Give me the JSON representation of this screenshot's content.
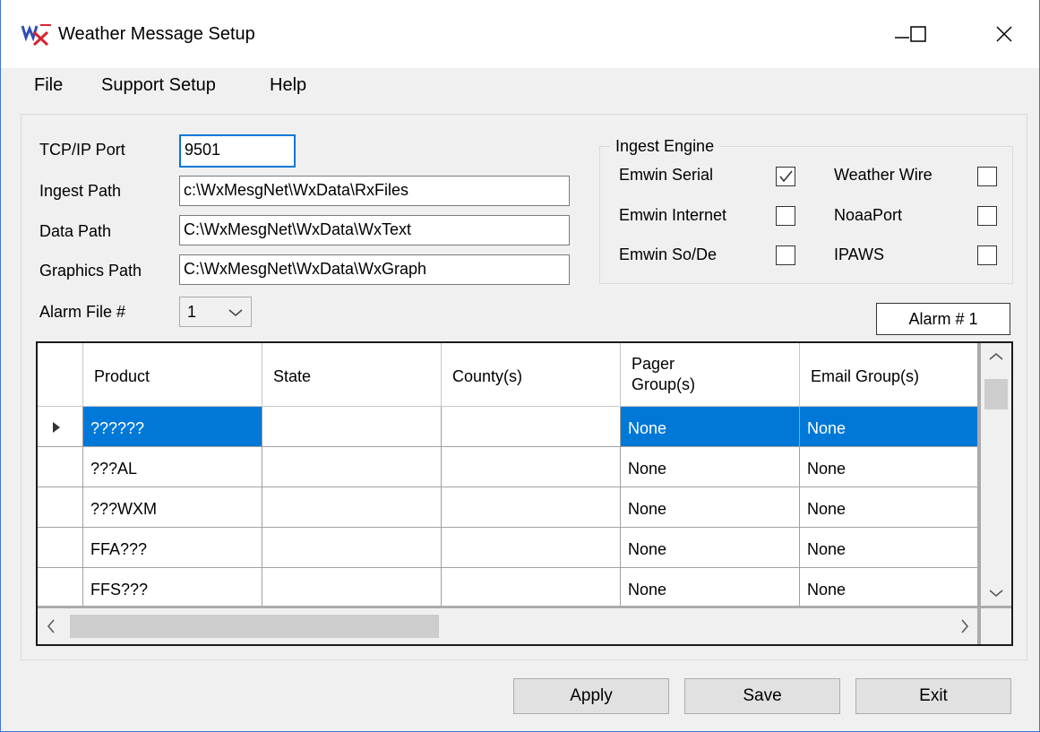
{
  "window": {
    "title": "Weather Message Setup"
  },
  "menu": {
    "file": "File",
    "support_setup": "Support Setup",
    "help": "Help"
  },
  "form": {
    "tcp_label": "TCP/IP Port",
    "tcp_value": "9501",
    "ingest_label": "Ingest Path",
    "ingest_value": "c:\\WxMesgNet\\WxData\\RxFiles",
    "data_label": "Data Path",
    "data_value": "C:\\WxMesgNet\\WxData\\WxText",
    "graphics_label": "Graphics Path",
    "graphics_value": "C:\\WxMesgNet\\WxData\\WxGraph",
    "alarm_label": "Alarm File #",
    "alarm_value": "1"
  },
  "ingest": {
    "legend": "Ingest Engine",
    "emwin_serial": "Emwin Serial",
    "emwin_internet": "Emwin Internet",
    "emwin_sode": "Emwin So/De",
    "weather_wire": "Weather Wire",
    "noaaport": "NoaaPort",
    "ipaws": "IPAWS",
    "checked": {
      "emwin_serial": true,
      "emwin_internet": false,
      "emwin_sode": false,
      "weather_wire": false,
      "noaaport": false,
      "ipaws": false
    }
  },
  "alarm_number": "Alarm # 1",
  "grid": {
    "headers": {
      "product": "Product",
      "state": "State",
      "county": "County(s)",
      "pager_1": "Pager",
      "pager_2": "Group(s)",
      "email": "Email Group(s)"
    },
    "rows": [
      {
        "product": "??????",
        "state": "",
        "county": "",
        "pager": "None",
        "email": "None"
      },
      {
        "product": "???AL",
        "state": "",
        "county": "",
        "pager": "None",
        "email": "None"
      },
      {
        "product": "???WXM",
        "state": "",
        "county": "",
        "pager": "None",
        "email": "None"
      },
      {
        "product": "FFA???",
        "state": "",
        "county": "",
        "pager": "None",
        "email": "None"
      },
      {
        "product": "FFS???",
        "state": "",
        "county": "",
        "pager": "None",
        "email": "None"
      }
    ]
  },
  "buttons": {
    "apply": "Apply",
    "save": "Save",
    "exit": "Exit"
  }
}
